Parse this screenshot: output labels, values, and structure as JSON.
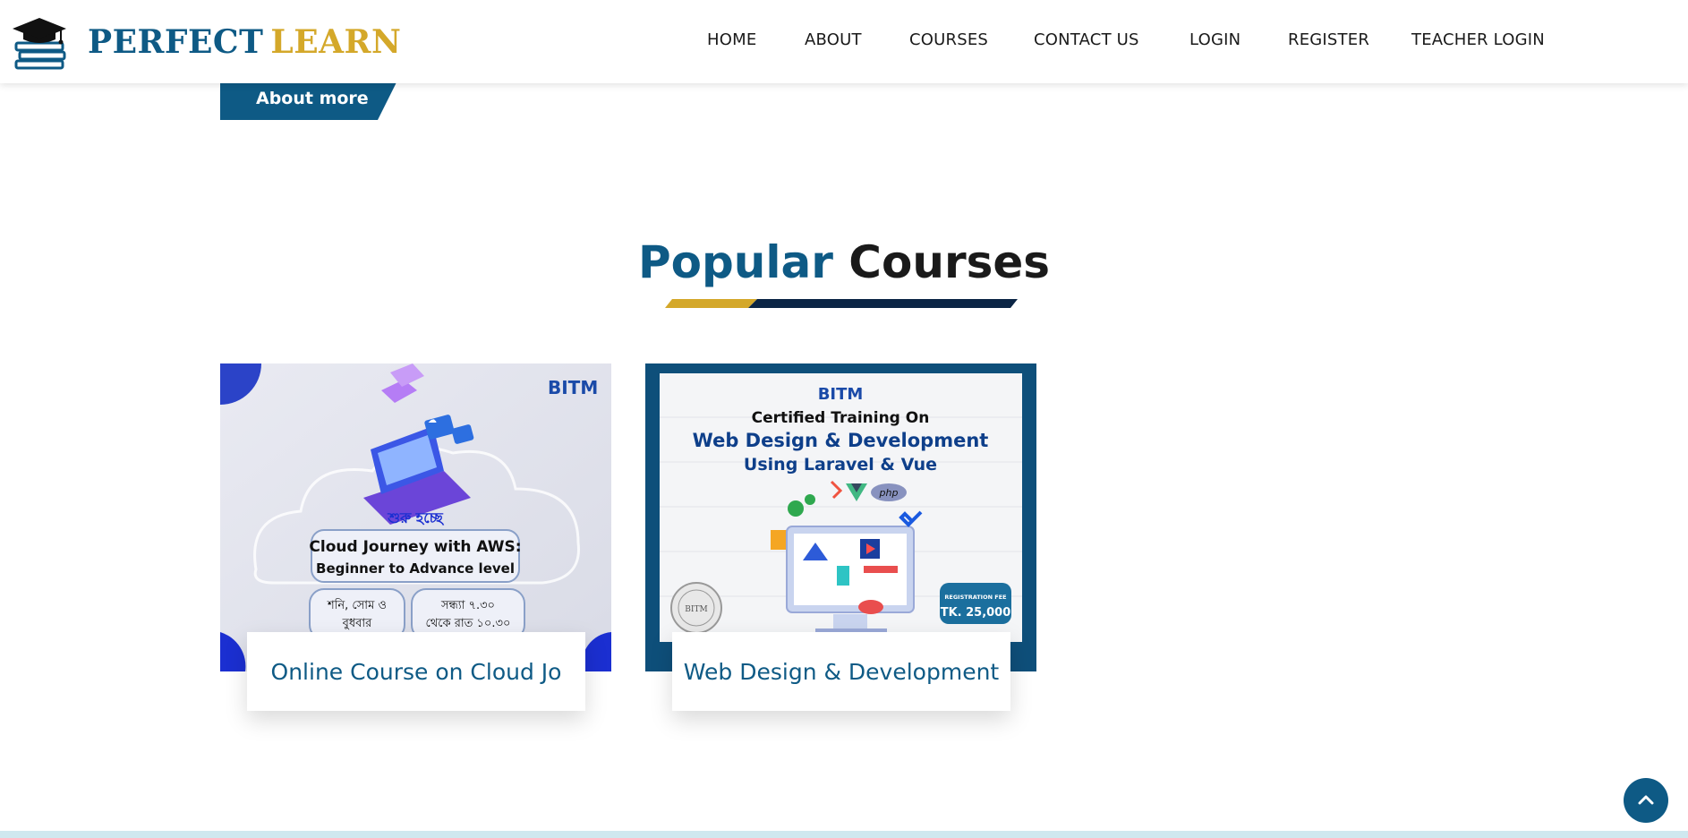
{
  "brand": {
    "word1": "PERFECT",
    "word2": "LEARN"
  },
  "nav": {
    "home": "HOME",
    "about": "ABOUT",
    "courses": "COURSES",
    "contact": "CONTACT US",
    "login": "LOGIN",
    "register": "REGISTER",
    "teacher_login": "TEACHER LOGIN"
  },
  "about_button": "About more",
  "section": {
    "highlight": "Popular",
    "rest": "Courses"
  },
  "courses": [
    {
      "title": "Online Course on Cloud Jo",
      "image": {
        "badge": "BITM",
        "bangla_tag": "শুরু হচ্ছে",
        "headline1": "Cloud Journey with AWS:",
        "headline2": "Beginner to Advance level",
        "days1": "শনি, সোম ও",
        "days2": "বুধবার",
        "time1": "সন্ধ্যা ৭.৩০",
        "time2": "থেকে রাত ১০.৩০"
      }
    },
    {
      "title": "Web Design & Development",
      "image": {
        "badge": "BITM",
        "line1": "Certified Training On",
        "line2": "Web Design & Development",
        "line3": "Using Laravel & Vue",
        "php": "php",
        "seal": "BITM",
        "fee_label": "REGISTRATION FEE",
        "fee": "TK. 25,000"
      }
    }
  ],
  "colors": {
    "primary": "#0e5a85",
    "accent": "#d4a82a",
    "dark": "#0b2545"
  },
  "icons": {
    "scroll_top": "chevron-up-icon"
  }
}
